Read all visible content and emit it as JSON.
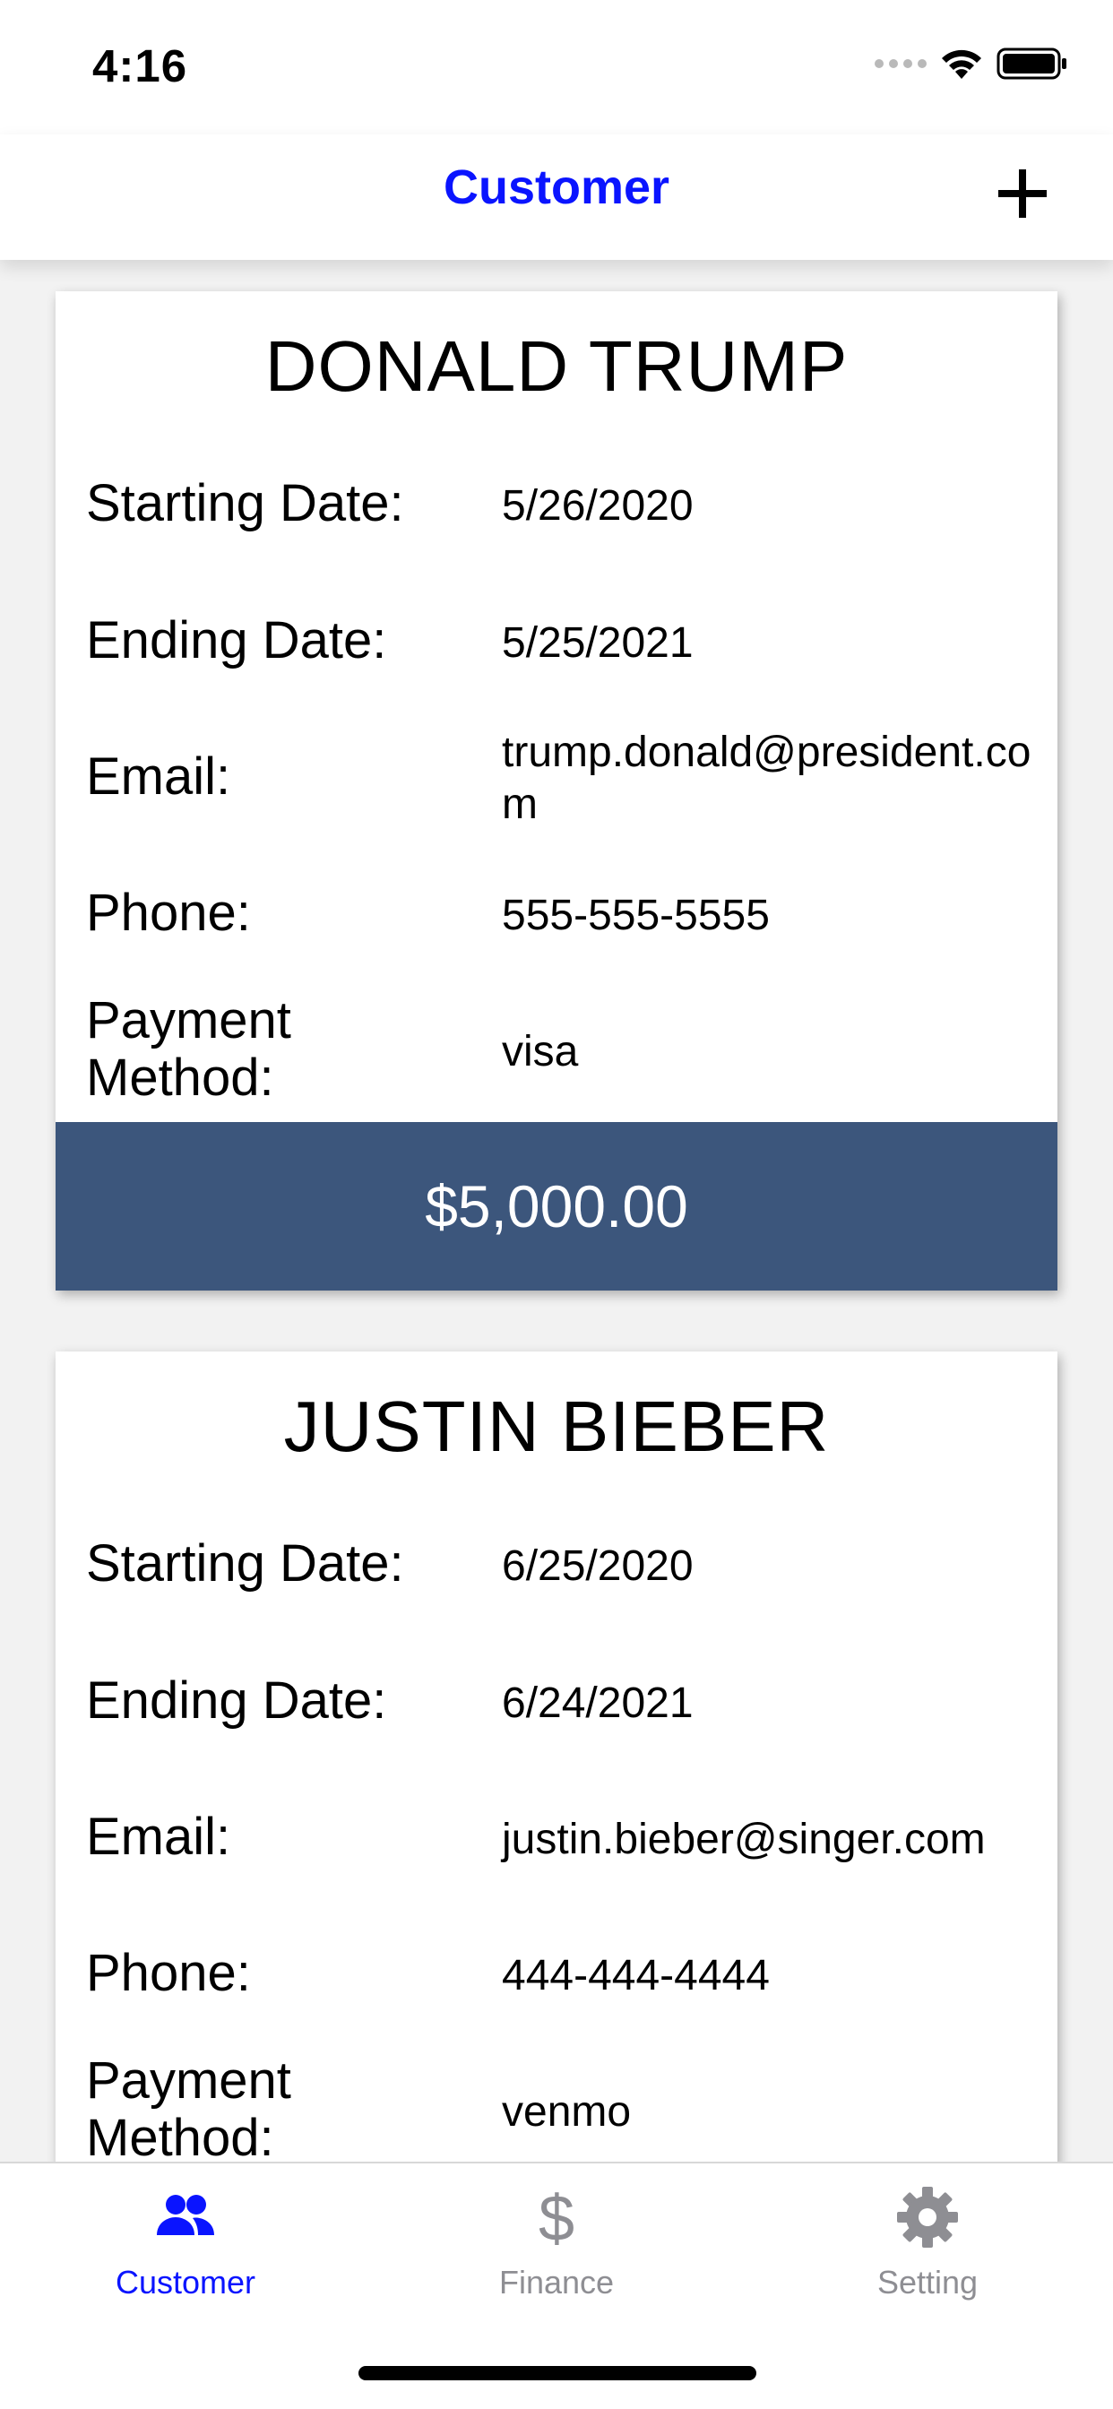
{
  "status_bar": {
    "time": "4:16"
  },
  "nav": {
    "title": "Customer",
    "add_icon": "plus-icon"
  },
  "labels": {
    "starting_date": "Starting Date:",
    "ending_date": "Ending Date:",
    "email": "Email:",
    "phone": "Phone:",
    "payment_method": "Payment Method:"
  },
  "customers": [
    {
      "name": "DONALD TRUMP",
      "starting_date": "5/26/2020",
      "ending_date": "5/25/2021",
      "email": "trump.donald@president.com",
      "phone": "555-555-5555",
      "payment_method": "visa",
      "amount": "$5,000.00"
    },
    {
      "name": "JUSTIN BIEBER",
      "starting_date": "6/25/2020",
      "ending_date": "6/24/2021",
      "email": "justin.bieber@singer.com",
      "phone": "444-444-4444",
      "payment_method": "venmo"
    }
  ],
  "tabs": [
    {
      "label": "Customer",
      "icon": "people-icon",
      "active": true
    },
    {
      "label": "Finance",
      "icon": "dollar-icon",
      "active": false
    },
    {
      "label": "Setting",
      "icon": "gear-icon",
      "active": false
    }
  ],
  "colors": {
    "accent": "#0a14ff",
    "price_bar": "#3c567c",
    "inactive": "#8e8e93"
  }
}
